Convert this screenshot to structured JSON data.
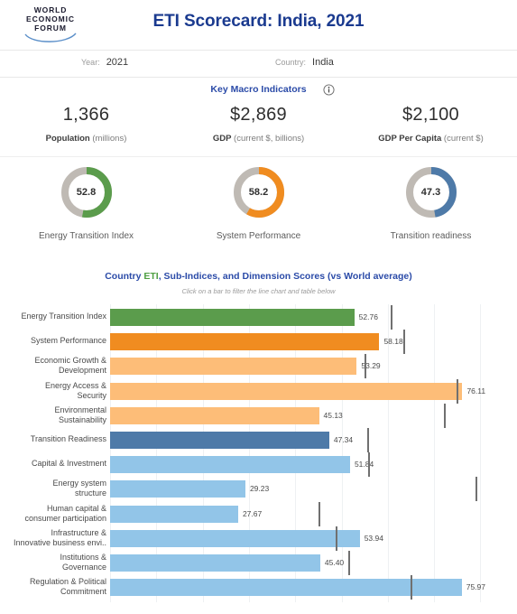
{
  "header": {
    "logo_lines": [
      "WORLD",
      "ECONOMIC",
      "FORUM"
    ],
    "logo_name": "world-economic-forum-logo",
    "title": "ETI Scorecard: India, 2021"
  },
  "filters": {
    "year": {
      "label": "Year:",
      "value": "2021"
    },
    "country": {
      "label": "Country:",
      "value": "India"
    }
  },
  "macro": {
    "title": "Key Macro Indicators",
    "info_icon": "info-icon",
    "items": [
      {
        "value": "1,366",
        "label_bold": "Population",
        "label_rest": " (millions)"
      },
      {
        "value": "$2,869",
        "label_bold": "GDP",
        "label_rest": " (current $, billions)"
      },
      {
        "value": "$2,100",
        "label_bold": "GDP Per Capita",
        "label_rest": " (current $)"
      }
    ]
  },
  "gauges": [
    {
      "value": "52.8",
      "pct": 52.8,
      "label": "Energy Transition Index",
      "color": "#5b9c4c"
    },
    {
      "value": "58.2",
      "pct": 58.2,
      "label": "System Performance",
      "color": "#f08c20"
    },
    {
      "value": "47.3",
      "pct": 47.3,
      "label": "Transition readiness",
      "color": "#4e7aa8"
    }
  ],
  "chart_header": {
    "title_pre": "Country ",
    "title_eti": "ETI",
    "title_post": ", Sub-Indices, and Dimension Scores (vs World average)",
    "subtitle": "Click on a bar to filter the line chart and table below"
  },
  "chart_data": {
    "type": "bar",
    "title": "Country ETI, Sub-Indices, and Dimension Scores (vs World average)",
    "xlabel": "",
    "ylabel": "",
    "xlim": [
      0,
      88
    ],
    "grid": true,
    "orientation": "horizontal",
    "reference_name": "World average",
    "categories": [
      "Energy Transition Index",
      "System Performance",
      "Economic Growth & Development",
      "Energy Access & Security",
      "Environmental Sustainability",
      "Transition Readiness",
      "Capital & Investment",
      "Energy system structure",
      "Human capital & consumer participation",
      "Infrastructure & Innovative business envi..",
      "Institutions & Governance",
      "Regulation & Political Commitment"
    ],
    "values": [
      52.76,
      58.18,
      53.29,
      76.11,
      45.13,
      47.34,
      51.84,
      29.23,
      27.67,
      53.94,
      45.4,
      75.97
    ],
    "value_labels": [
      "52.76",
      "58.18",
      "53.29",
      "76.11",
      "45.13",
      "47.34",
      "51.84",
      "29.23",
      "27.67",
      "53.94",
      "45.40",
      "75.97"
    ],
    "world_average": [
      60.7,
      63.3,
      55.0,
      74.9,
      72.2,
      55.6,
      55.7,
      79.0,
      45.0,
      48.8,
      51.5,
      65.0
    ],
    "colors": [
      "#5b9c4c",
      "#f08c20",
      "#fdbd78",
      "#fdbd78",
      "#fdbd78",
      "#4e7aa8",
      "#92c5e8",
      "#92c5e8",
      "#92c5e8",
      "#92c5e8",
      "#92c5e8",
      "#92c5e8"
    ],
    "label_lines": [
      [
        "Energy Transition Index"
      ],
      [
        "System Performance"
      ],
      [
        "Economic Growth &",
        "Development"
      ],
      [
        "Energy Access &",
        "Security"
      ],
      [
        "Environmental",
        "Sustainability"
      ],
      [
        "Transition Readiness"
      ],
      [
        "Capital & Investment"
      ],
      [
        "Energy system",
        "structure"
      ],
      [
        "Human capital &",
        "consumer participation"
      ],
      [
        "Infrastructure &",
        "Innovative business envi.."
      ],
      [
        "Institutions &",
        "Governance"
      ],
      [
        "Regulation & Political",
        "Commitment"
      ]
    ]
  }
}
